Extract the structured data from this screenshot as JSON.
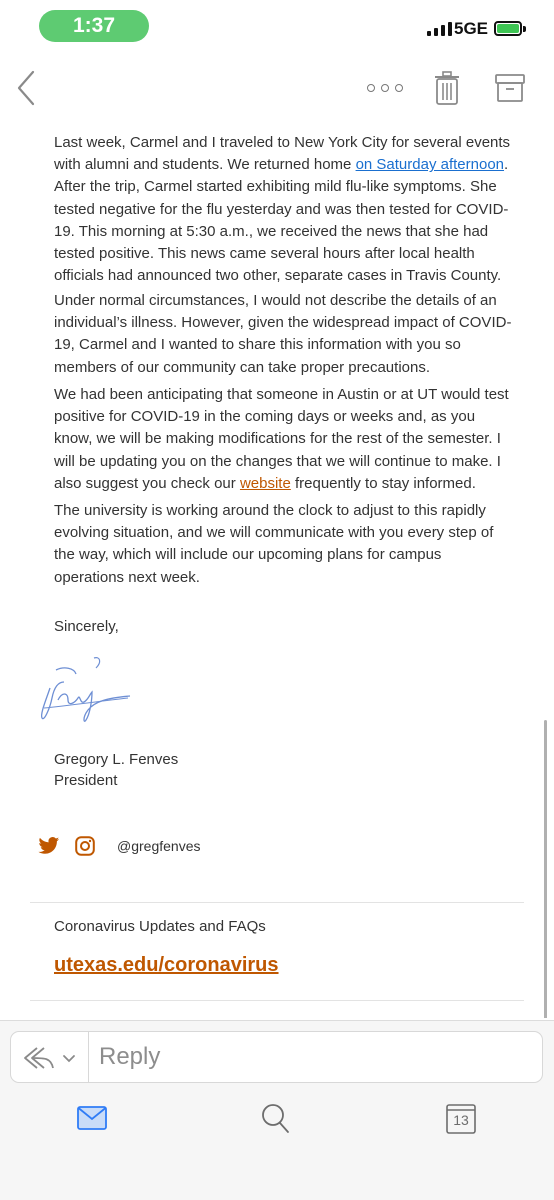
{
  "status_bar": {
    "time": "1:37",
    "network": "5GE"
  },
  "email": {
    "paragraphs": {
      "p1": {
        "before_link": "Last week, Carmel and I traveled to New York City for several events with alumni and students. We returned home ",
        "link": "on Saturday afternoon",
        "after_link": ". After the trip, Carmel started exhibiting mild flu-like symptoms. She tested negative for the flu yesterday and was then tested for COVID-19. This morning at 5:30 a.m., we received the news that she had tested positive. This news came several hours after local health officials had announced two other, separate cases in Travis County."
      },
      "p2": "Under normal circumstances, I would not describe the details of an individual’s illness. However, given the widespread impact of COVID-19, Carmel and I wanted to share this information with you so members of our community can take proper precautions.",
      "p3": {
        "before_link": "We had been anticipating that someone in Austin or at UT would test positive for COVID-19 in the coming days or weeks and, as you know, we will be making modifications for the rest of the semester. I will be updating you on the changes that we will continue to make. I also suggest you check our ",
        "link": "website",
        "after_link": " frequently to stay informed."
      },
      "p4": "The university is working around the clock to adjust to this rapidly evolving situation, and we will communicate with you every step of the way, which will include our upcoming plans for campus operations next week."
    },
    "closing": "Sincerely,",
    "signer_name": "Gregory L. Fenves",
    "signer_title": "President",
    "social_handle": "@gregfenves",
    "faq_label": "Coronavirus Updates and FAQs",
    "faq_link": "utexas.edu/coronavirus"
  },
  "reply": {
    "placeholder": "Reply"
  },
  "tabs": {
    "calendar_day": "13"
  },
  "icons": [
    "back-chevron-icon",
    "more-icon",
    "trash-icon",
    "archive-icon",
    "twitter-icon",
    "instagram-icon",
    "reply-arrows-icon",
    "chevron-down-icon",
    "mail-icon",
    "search-icon",
    "calendar-icon"
  ],
  "colors": {
    "accent_orange": "#bf5700",
    "link_blue": "#1a6fcf",
    "ios_blue": "#2f7cf6",
    "status_green": "#5ecb72"
  }
}
